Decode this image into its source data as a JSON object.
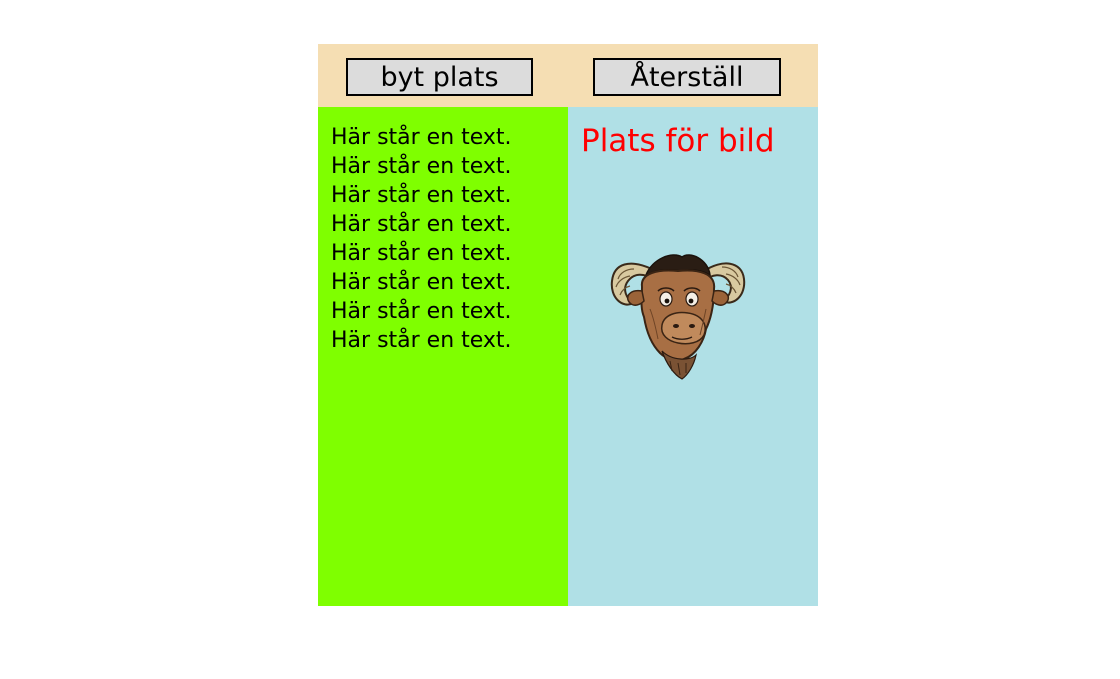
{
  "toolbar": {
    "swap_label": "byt plats",
    "reset_label": "Återställ"
  },
  "left_panel": {
    "lines": [
      "Här står en text.",
      "Här står en text.",
      "Här står en text.",
      "Här står en text.",
      "Här står en text.",
      "Här står en text.",
      "Här står en text.",
      "Här står en text."
    ]
  },
  "right_panel": {
    "caption": "Plats för bild",
    "image_icon": "gnu-head-icon"
  },
  "colors": {
    "toolbar_bg": "#f5deb3",
    "left_panel_bg": "#7fff00",
    "right_panel_bg": "#b0e0e6",
    "caption_color": "#ff0000",
    "button_bg": "#dcdcdc"
  }
}
